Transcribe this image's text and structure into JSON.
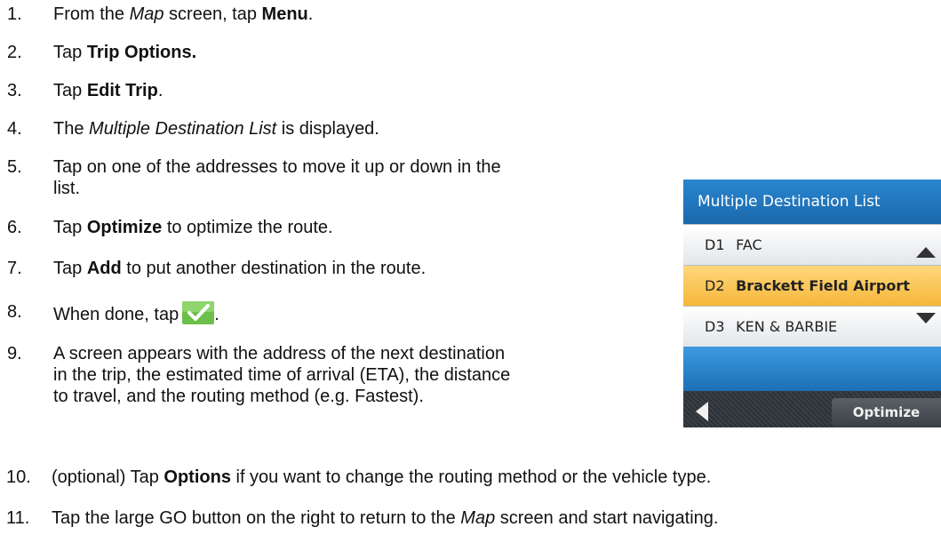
{
  "steps": [
    {
      "n": "1.",
      "parts": [
        "From the ",
        "Map",
        " screen, tap ",
        "Menu",
        "."
      ]
    },
    {
      "n": "2.",
      "parts": [
        "Tap ",
        "Trip Options."
      ]
    },
    {
      "n": "3.",
      "parts": [
        "Tap ",
        "Edit Trip",
        "."
      ]
    },
    {
      "n": "4.",
      "parts": [
        "The ",
        "Multiple Destination List",
        " is displayed."
      ]
    },
    {
      "n": "5.",
      "lines": [
        "Tap on one of the addresses to move it up or down in the",
        "list."
      ]
    },
    {
      "n": "6.",
      "parts": [
        "Tap ",
        "Optimize",
        " to optimize the route."
      ]
    },
    {
      "n": "7.",
      "parts": [
        "Tap ",
        "Add",
        " to put another destination in the route."
      ]
    },
    {
      "n": "8.",
      "parts": [
        "When done, tap",
        "."
      ]
    },
    {
      "n": "9.",
      "lines": [
        " A screen appears with the address of the next destination",
        "in the trip, the estimated time of arrival (ETA), the distance",
        "to travel, and the routing method (e.g. Fastest)."
      ]
    },
    {
      "n": "10.",
      "parts": [
        "(optional) Tap ",
        "Options",
        " if you want to change the routing method or the vehicle type."
      ]
    },
    {
      "n": "11.",
      "parts": [
        "Tap the large GO button on the right to return to the ",
        "Map",
        " screen and start navigating."
      ]
    }
  ],
  "device": {
    "title": "Multiple Destination List",
    "rows": [
      {
        "code": "D1",
        "name": "FAC",
        "selected": false
      },
      {
        "code": "D2",
        "name": "Brackett Field Airport",
        "selected": true
      },
      {
        "code": "D3",
        "name": "KEN & BARBIE",
        "selected": false
      }
    ],
    "optimize_label": "Optimize",
    "colors": {
      "header": "#1a68ad",
      "selected": "#f6b73a",
      "checkmark": "#3aa63a"
    },
    "icons": [
      "scroll-up-icon",
      "scroll-down-icon",
      "back-arrow-icon",
      "checkmark-icon"
    ]
  }
}
